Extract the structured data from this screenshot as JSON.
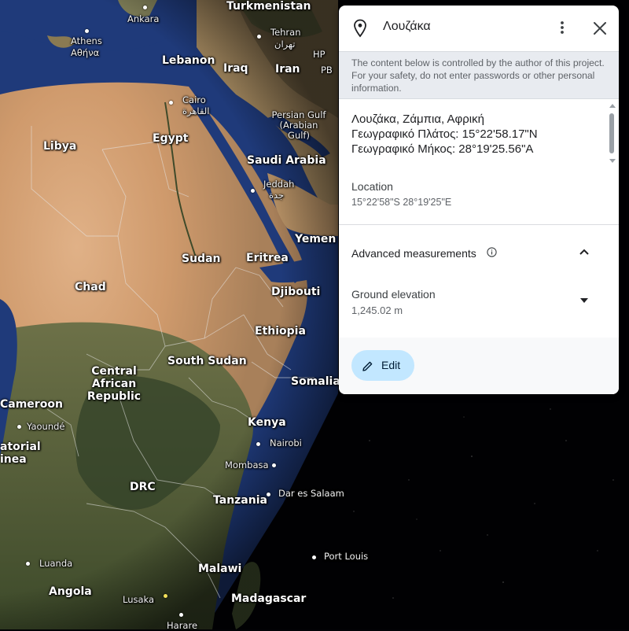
{
  "panel": {
    "title": "Λουζάκα",
    "notice": "The content below is controlled by the author of this project. For your safety, do not enter passwords or other personal information.",
    "description": [
      "Λουζάκα, Ζάμπια, Αφρική",
      "Γεωγραφικό Πλάτος: 15°22'58.17\"N",
      "Γεωγραφικό Μήκος: 28°19'25.56\"A"
    ],
    "location_label": "Location",
    "location_value": "15°22'58\"S 28°19'25\"E",
    "advanced_label": "Advanced measurements",
    "elevation_label": "Ground elevation",
    "elevation_value": "1,245.02 m",
    "edit_label": "Edit",
    "accent_color": "#c2e7ff",
    "icons": {
      "pin": "place-icon",
      "menu": "more-vert-icon",
      "close": "close-icon",
      "info": "info-icon",
      "collapse": "chevron-up-icon",
      "expand": "caret-down-icon",
      "edit": "pencil-icon"
    }
  },
  "map_labels": {
    "countries": {
      "turkmenistan": "Turkmenistan",
      "lebanon": "Lebanon",
      "iraq": "Iraq",
      "iran": "Iran",
      "libya": "Libya",
      "egypt": "Egypt",
      "saudi_arabia": "Saudi Arabia",
      "yemen": "Yemen",
      "sudan": "Sudan",
      "eritrea": "Eritrea",
      "chad": "Chad",
      "djibouti": "Djibouti",
      "ethiopia": "Ethiopia",
      "south_sudan": "South Sudan",
      "central_african_republic": "Central African Republic",
      "somalia": "Somalia",
      "cameroon": "Cameroon",
      "kenya": "Kenya",
      "drc": "DRC",
      "tanzania": "Tanzania",
      "equatorial_guinea": "atorial inea",
      "malawi": "Malawi",
      "angola": "Angola",
      "madagascar": "Madagascar",
      "hp": "HP",
      "pb": "PB"
    },
    "cities": {
      "ankara": "Ankara",
      "athens": "Athens",
      "athens_local": "Αθήνα",
      "tehran": "Tehran",
      "tehran_local": "تهران",
      "cairo": "Cairo",
      "cairo_local": "القاهرة",
      "persian_gulf": "Persian Gulf (Arabian Gulf)",
      "jeddah": "Jeddah",
      "jeddah_local": "جدة",
      "yaounde": "Yaoundé",
      "nairobi": "Nairobi",
      "mombasa": "Mombasa",
      "dar_es_salaam": "Dar es Salaam",
      "luanda": "Luanda",
      "port_louis": "Port Louis",
      "lusaka": "Lusaka",
      "harare": "Harare"
    }
  }
}
